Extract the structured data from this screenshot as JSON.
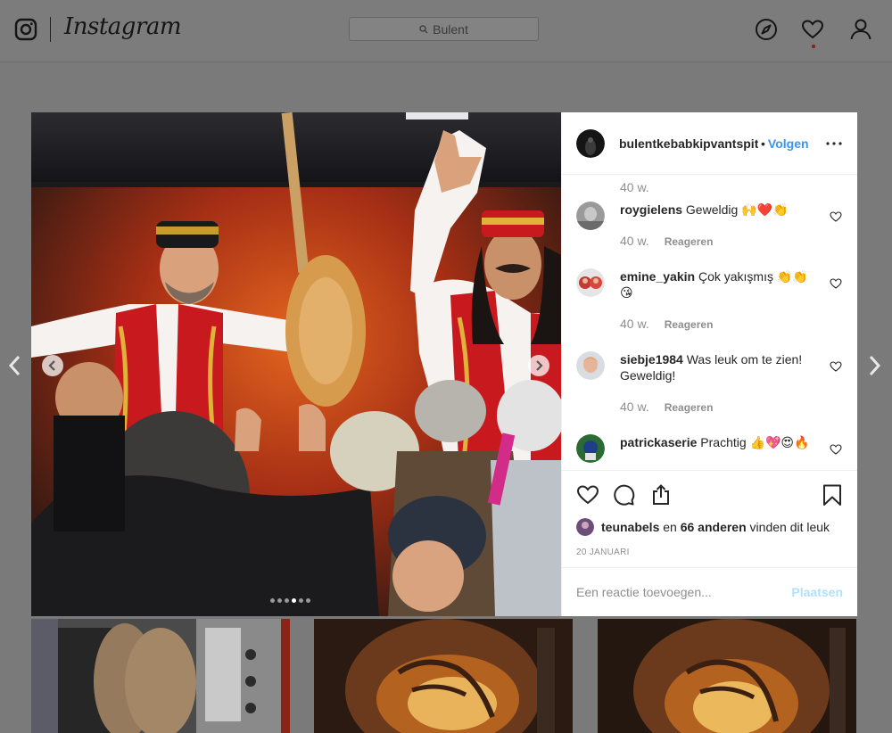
{
  "nav": {
    "wordmark": "Instagram",
    "search_value": "Bulent"
  },
  "post": {
    "username": "bulentkebabkipvantspit",
    "separator": "•",
    "follow_label": "Volgen",
    "top_time": "40 w.",
    "comments": [
      {
        "user": "roygielens",
        "text": "Geweldig 🙌❤️👏",
        "time": "40 w.",
        "reply": "Reageren"
      },
      {
        "user": "emine_yakin",
        "text": "Çok yakışmış 👏👏😘",
        "time": "40 w.",
        "reply": "Reageren"
      },
      {
        "user": "siebje1984",
        "text": "Was leuk om te zien! Geweldig!",
        "time": "40 w.",
        "reply": "Reageren"
      },
      {
        "user": "patrickaserie",
        "text": "Prachtig 👍💖😍🔥"
      }
    ],
    "likes": {
      "user": "teunabels",
      "and": "en",
      "others": "66 anderen",
      "suffix": "vinden dit leuk"
    },
    "date": "20 JANUARI",
    "comment_placeholder": "Een reactie toevoegen...",
    "post_button": "Plaatsen",
    "carousel": {
      "count": 6,
      "active_index": 3
    }
  },
  "colors": {
    "accent": "#3897f0",
    "overlay": "#7a7a7a",
    "post_disabled": "#b2dffc"
  }
}
